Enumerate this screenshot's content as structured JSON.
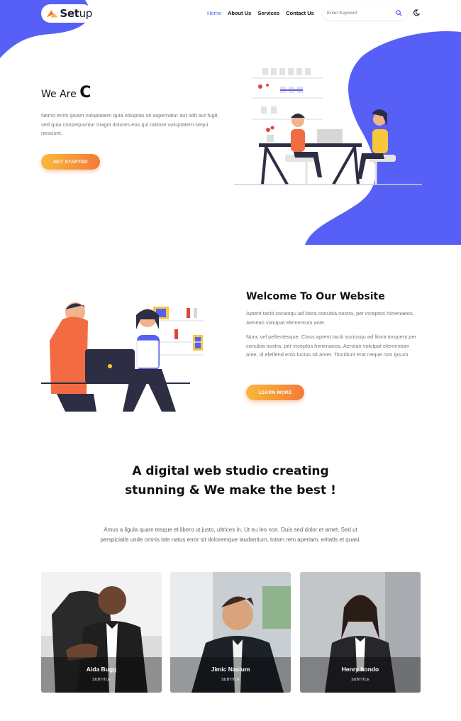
{
  "brand": {
    "logo_text": "Set",
    "logo_text_light": "up",
    "accent": "#5660f7",
    "orange": "#f37b39"
  },
  "nav": {
    "items": [
      {
        "label": "Home",
        "active": true
      },
      {
        "label": "About Us",
        "active": false
      },
      {
        "label": "Services",
        "active": false
      },
      {
        "label": "Contact Us",
        "active": false
      }
    ]
  },
  "search": {
    "placeholder": "Enter Keyword",
    "icon": "search-icon"
  },
  "theme_toggle": {
    "icon": "moon-icon"
  },
  "hero": {
    "title_prefix": "We Are",
    "title_letter": "C",
    "text": "Nemo enim ipsam voluptatem quia voluptas sit aspernatur aut odit aut fugit, sed quia consequuntur magni dolores eos qui ratione voluptatem sequi nesciunt.",
    "cta": "GET STARTED"
  },
  "welcome": {
    "title": "Welcome To Our Website",
    "p1": "Aptent taciti sociosqu ad litora conubia nostra, per inceptos himenaeos. Aenean volutpat elementum ante.",
    "p2": "Nunc vel pellentesque. Class aptent taciti sociosqu ad litora torquent per conubia nostra, per inceptos himenaeos. Aenean volutpat elementum ante, id eleifend eros luctus sit amet. Tincidunt erat neque non ipsum.",
    "cta": "LEARN MORE"
  },
  "studio": {
    "title": "A digital web studio creating stunning & We make the best !",
    "text": "Amus a ligula quam tesque et libero ut justo, ultrices in. Ut eu leo non. Duis sed dolor et amet. Sed ut perspiciatis unde omnis iste natus error sit doloremque laudantium, totam rem aperiam, eritatis et quasi."
  },
  "team": [
    {
      "name": "Aida Bugg",
      "subtitle": "SUBTITLE"
    },
    {
      "name": "Jimic Nasium",
      "subtitle": "SUBTITLE"
    },
    {
      "name": "Henry Itondo",
      "subtitle": "SUBTITLE"
    }
  ]
}
